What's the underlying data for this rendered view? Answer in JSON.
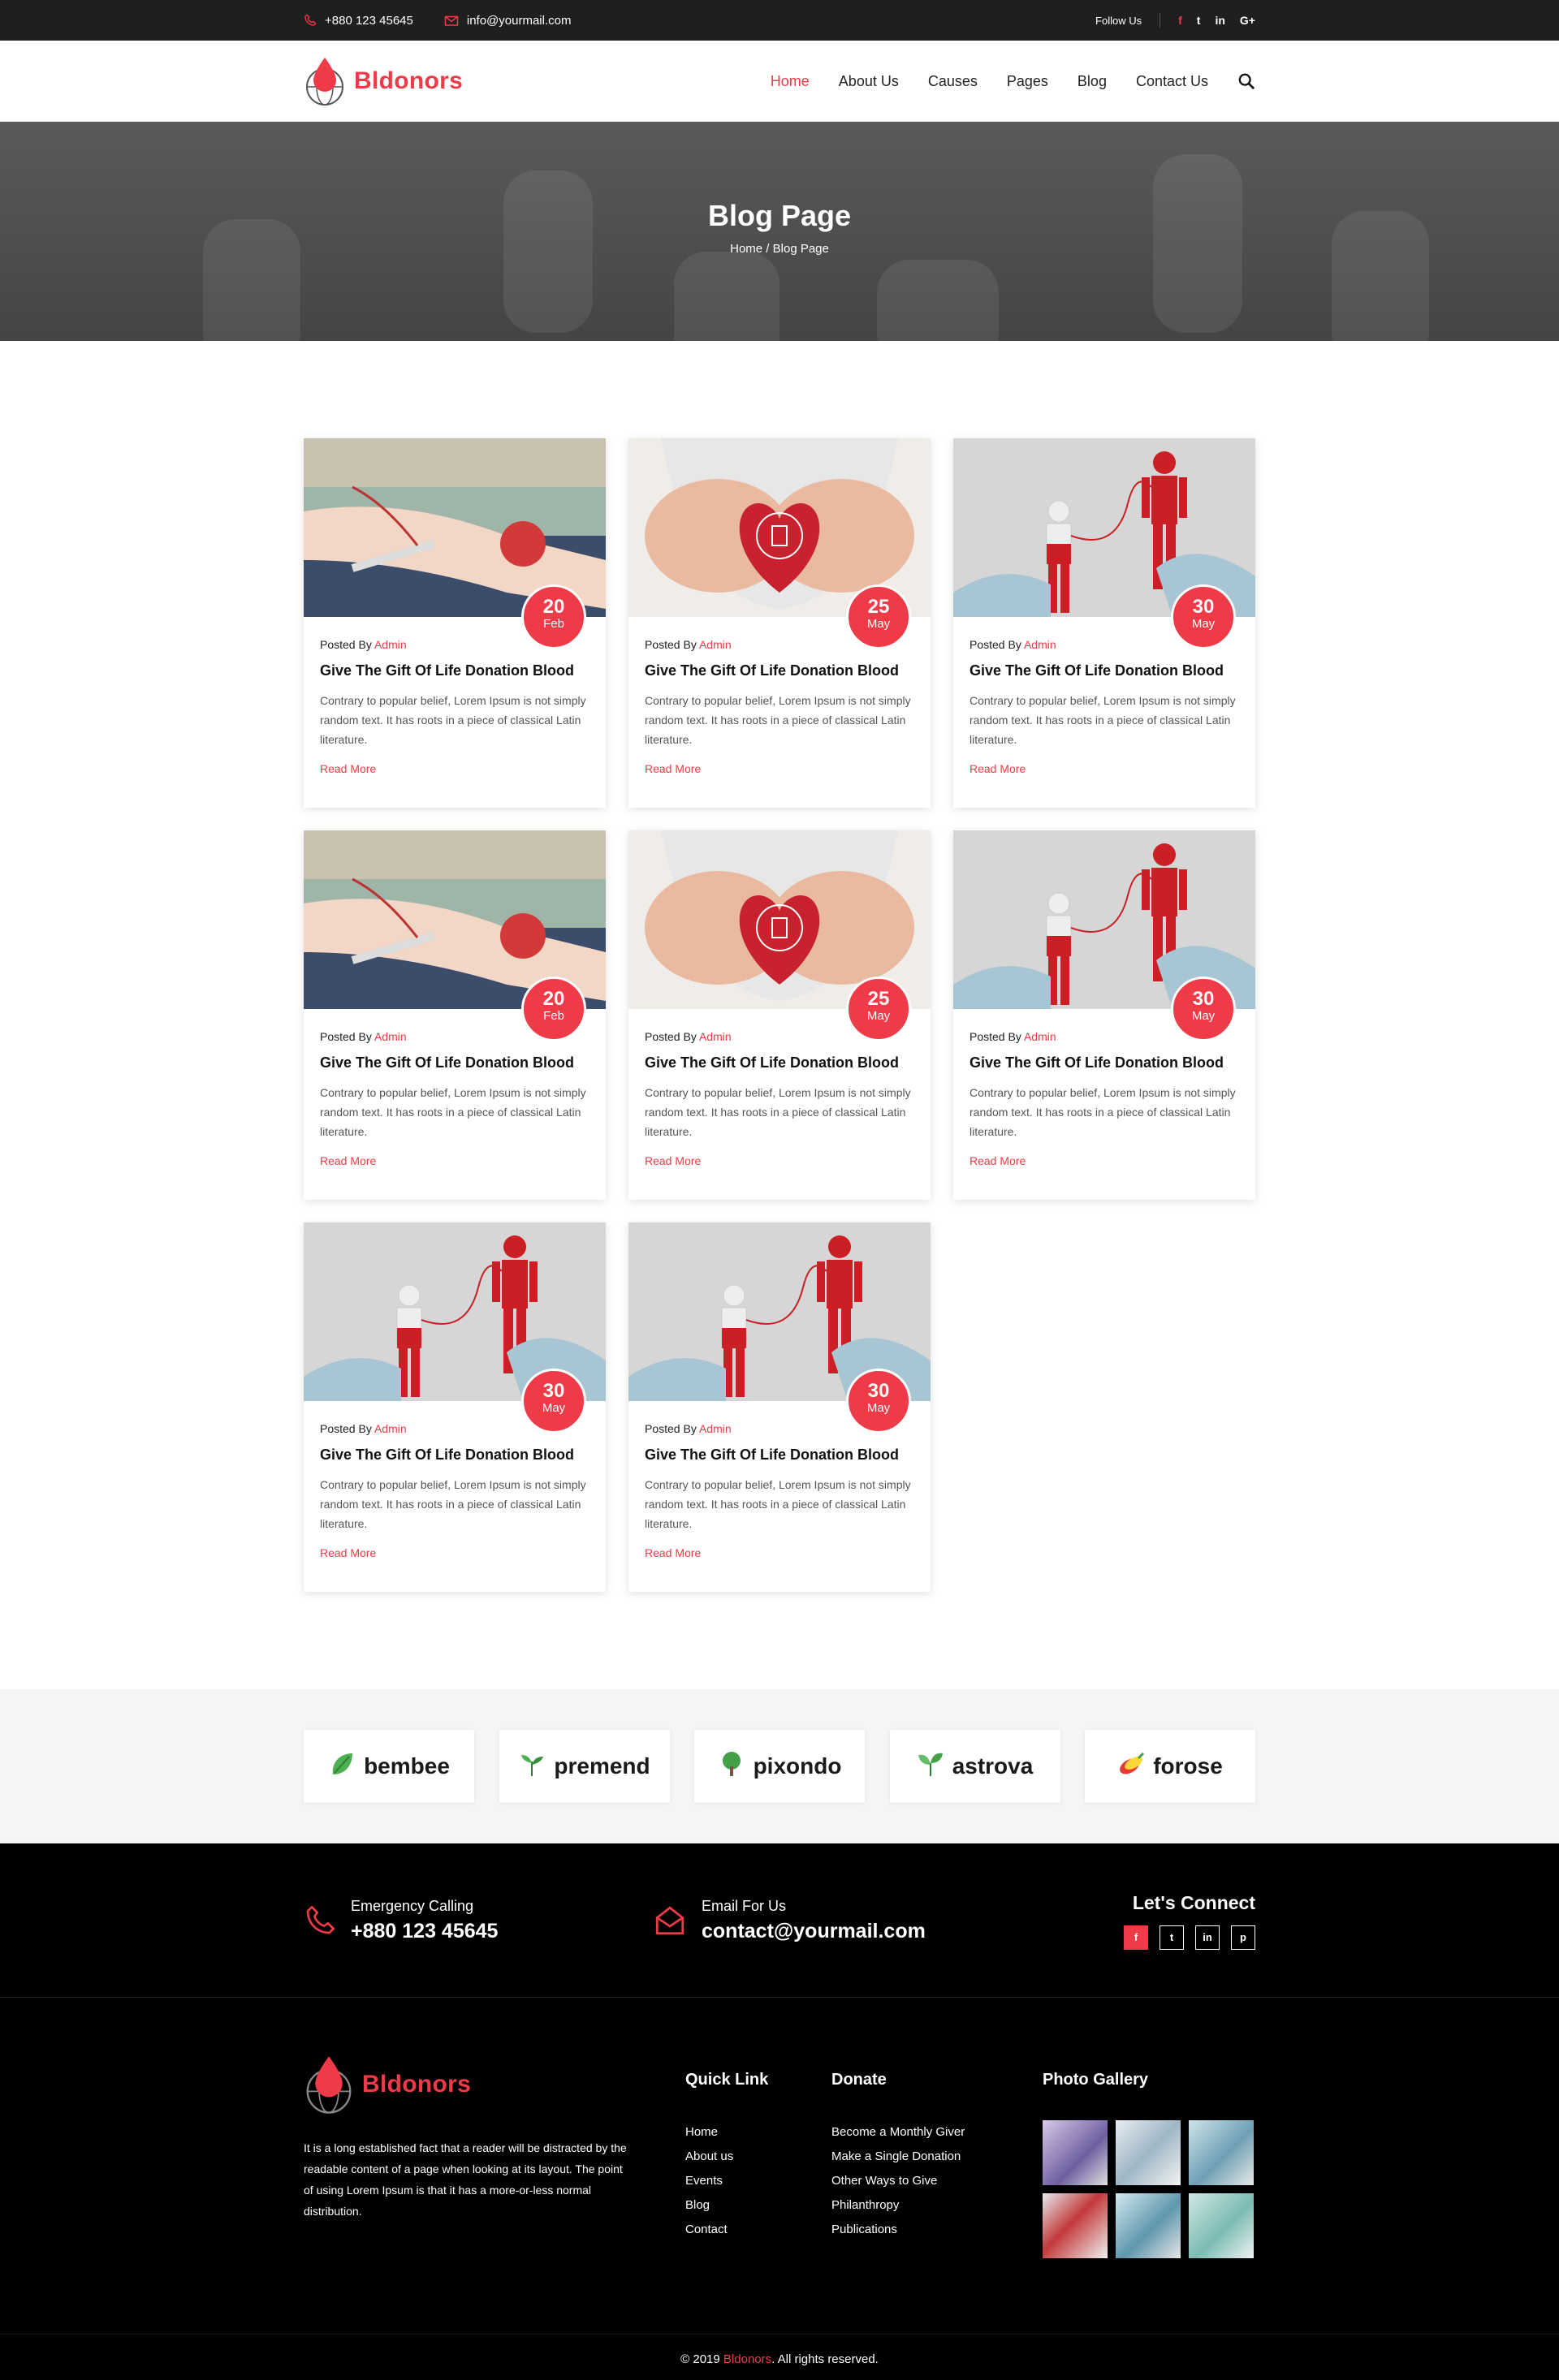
{
  "topbar": {
    "phone": "+880 123 45645",
    "email": "info@yourmail.com",
    "follow_label": "Follow Us",
    "social": [
      "f",
      "t",
      "in",
      "G+"
    ]
  },
  "header": {
    "logo_text": "Bldonors",
    "nav": [
      "Home",
      "About Us",
      "Causes",
      "Pages",
      "Blog",
      "Contact Us"
    ],
    "active_nav": "Home"
  },
  "banner": {
    "title": "Blog Page",
    "breadcrumb": "Home / Blog Page"
  },
  "posts": [
    {
      "day": "20",
      "month": "Feb",
      "posted_label": "Posted By",
      "author": "Admin",
      "title": "Give The Gift Of Life Donation Blood",
      "text": "Contrary to popular belief, Lorem Ipsum is not simply random text. It has roots in a piece of classical Latin literature.",
      "read_more": "Read More",
      "image": "arm-donation"
    },
    {
      "day": "25",
      "month": "May",
      "posted_label": "Posted By",
      "author": "Admin",
      "title": "Give The Gift Of Life Donation Blood",
      "text": "Contrary to popular belief, Lorem Ipsum is not simply random text. It has roots in a piece of classical Latin literature.",
      "read_more": "Read More",
      "image": "heart-hands"
    },
    {
      "day": "30",
      "month": "May",
      "posted_label": "Posted By",
      "author": "Admin",
      "title": "Give The Gift Of Life Donation Blood",
      "text": "Contrary to popular belief, Lorem Ipsum is not simply random text. It has roots in a piece of classical Latin literature.",
      "read_more": "Read More",
      "image": "transfusion"
    },
    {
      "day": "20",
      "month": "Feb",
      "posted_label": "Posted By",
      "author": "Admin",
      "title": "Give The Gift Of Life Donation Blood",
      "text": "Contrary to popular belief, Lorem Ipsum is not simply random text. It has roots in a piece of classical Latin literature.",
      "read_more": "Read More",
      "image": "arm-donation"
    },
    {
      "day": "25",
      "month": "May",
      "posted_label": "Posted By",
      "author": "Admin",
      "title": "Give The Gift Of Life Donation Blood",
      "text": "Contrary to popular belief, Lorem Ipsum is not simply random text. It has roots in a piece of classical Latin literature.",
      "read_more": "Read More",
      "image": "heart-hands"
    },
    {
      "day": "30",
      "month": "May",
      "posted_label": "Posted By",
      "author": "Admin",
      "title": "Give The Gift Of Life Donation Blood",
      "text": "Contrary to popular belief, Lorem Ipsum is not simply random text. It has roots in a piece of classical Latin literature.",
      "read_more": "Read More",
      "image": "transfusion"
    },
    {
      "day": "30",
      "month": "May",
      "posted_label": "Posted By",
      "author": "Admin",
      "title": "Give The Gift Of Life Donation Blood",
      "text": "Contrary to popular belief, Lorem Ipsum is not simply random text. It has roots in a piece of classical Latin literature.",
      "read_more": "Read More",
      "image": "transfusion"
    },
    {
      "day": "30",
      "month": "May",
      "posted_label": "Posted By",
      "author": "Admin",
      "title": "Give The Gift Of Life Donation Blood",
      "text": "Contrary to popular belief, Lorem Ipsum is not simply random text. It has roots in a piece of classical Latin literature.",
      "read_more": "Read More",
      "image": "transfusion"
    }
  ],
  "brands": [
    {
      "name": "bembee",
      "icon": "leaf-icon"
    },
    {
      "name": "premend",
      "icon": "sprout-icon"
    },
    {
      "name": "pixondo",
      "icon": "tree-icon"
    },
    {
      "name": "astrova",
      "icon": "seedling-icon"
    },
    {
      "name": "forose",
      "icon": "corn-icon"
    }
  ],
  "footer": {
    "emergency_label": "Emergency Calling",
    "emergency_phone": "+880 123 45645",
    "email_label": "Email For Us",
    "email": "contact@yourmail.com",
    "connect_title": "Let's Connect",
    "connect_social": [
      "f",
      "t",
      "in",
      "p"
    ],
    "logo_text": "Bldonors",
    "about": "It is a long established fact that a reader will be distracted by the readable content of a page when looking at its layout. The point of using Lorem Ipsum is that it has a more-or-less normal distribution.",
    "quick_link_title": "Quick Link",
    "quick_links": [
      "Home",
      "About us",
      "Events",
      "Blog",
      "Contact"
    ],
    "donate_title": "Donate",
    "donate_links": [
      "Become a Monthly Giver",
      "Make a Single Donation",
      "Other Ways to Give",
      "Philanthropy",
      "Publications"
    ],
    "gallery_title": "Photo Gallery",
    "copyright_prefix": "© 2019",
    "copyright_brand": "Bldonors",
    "copyright_suffix": ". All rights reserved."
  },
  "colors": {
    "accent": "#ef3a47",
    "dark": "#1f1f1f"
  }
}
